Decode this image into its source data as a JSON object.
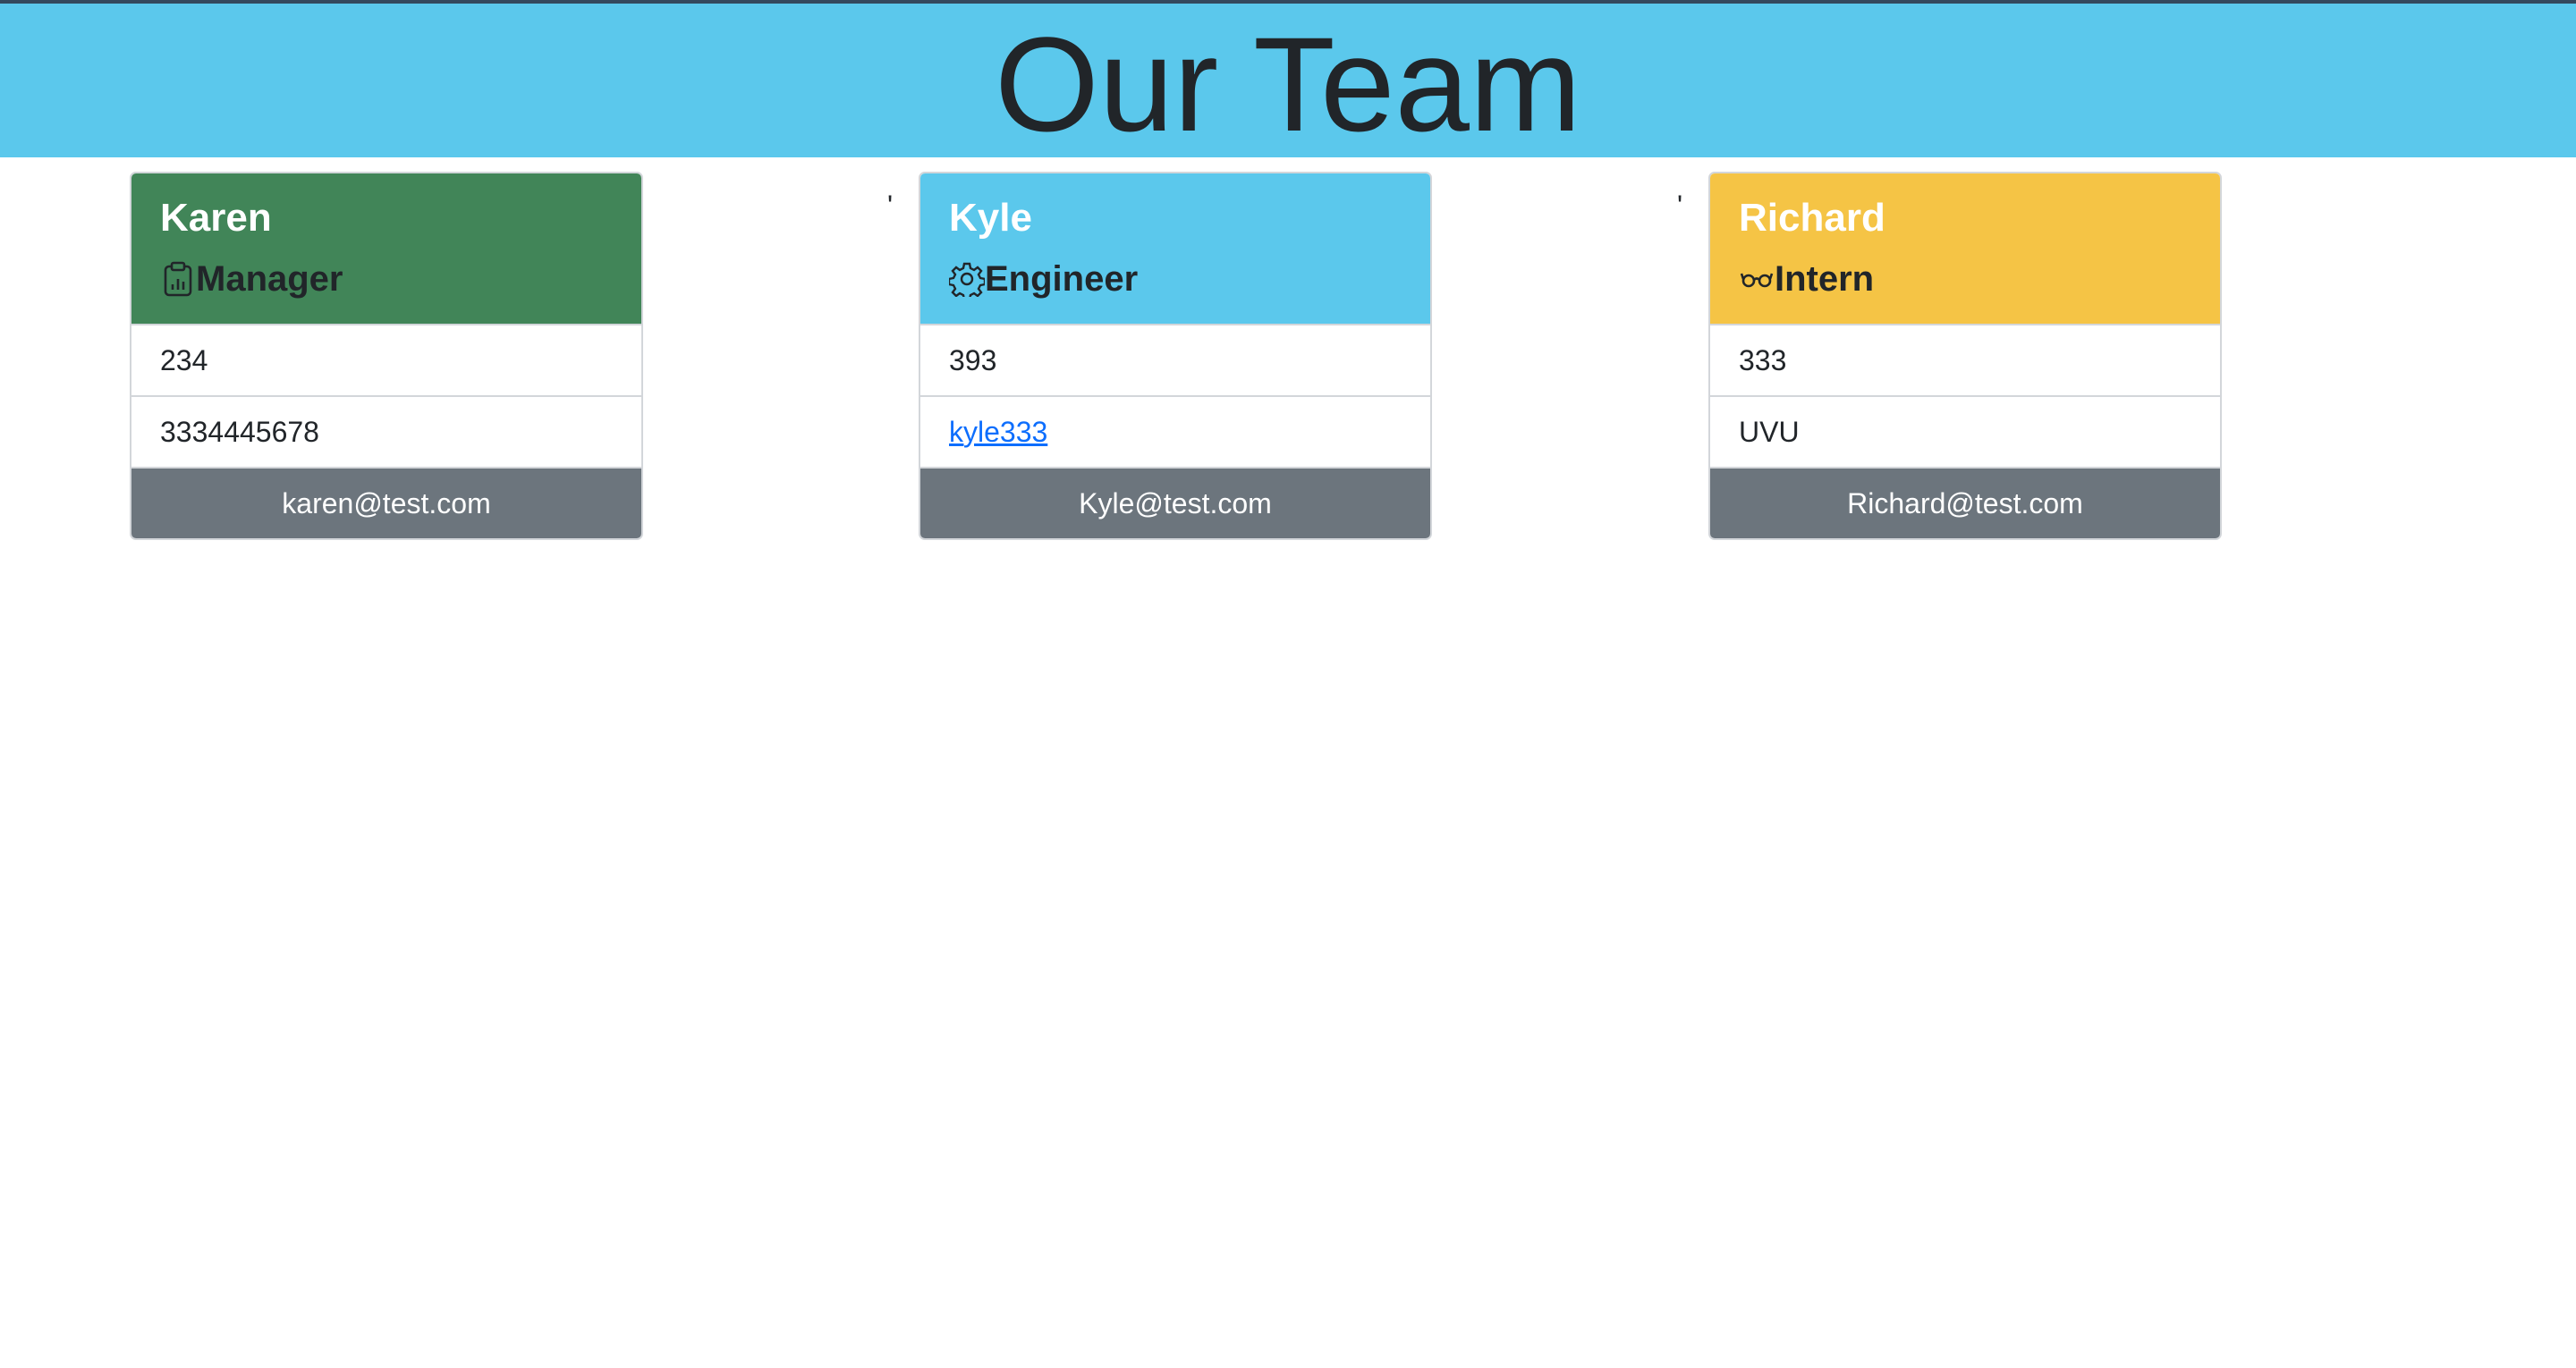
{
  "page": {
    "title": "Our Team",
    "header_bg": "#5bc8ec"
  },
  "separators": [
    "'",
    "'"
  ],
  "members": [
    {
      "name": "Karen",
      "role": "Manager",
      "role_icon": "clipboard-data-icon",
      "header_color": "#418558",
      "id": "234",
      "detail": "3334445678",
      "detail_is_link": false,
      "email": "karen@test.com"
    },
    {
      "name": "Kyle",
      "role": "Engineer",
      "role_icon": "gear-icon",
      "header_color": "#5bc8ec",
      "id": "393",
      "detail": "kyle333",
      "detail_is_link": true,
      "email": "Kyle@test.com"
    },
    {
      "name": "Richard",
      "role": "Intern",
      "role_icon": "eyeglasses-icon",
      "header_color": "#f5c445",
      "id": "333",
      "detail": "UVU",
      "detail_is_link": false,
      "email": "Richard@test.com"
    }
  ]
}
